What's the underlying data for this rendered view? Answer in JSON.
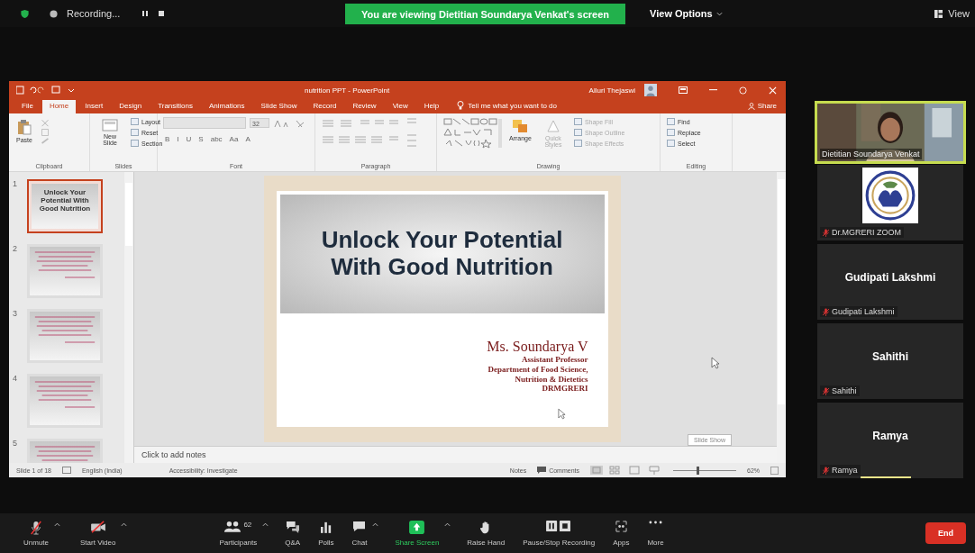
{
  "meeting_bar": {
    "recording": "Recording...",
    "banner": "You are viewing Dietitian Soundarya Venkat's screen",
    "view_options": "View Options",
    "view": "View"
  },
  "powerpoint": {
    "title": "nutrition PPT - PowerPoint",
    "user": "Alluri Thejaswi",
    "tabs": [
      {
        "label": "File",
        "selected": false
      },
      {
        "label": "Home",
        "selected": true
      },
      {
        "label": "Insert",
        "selected": false
      },
      {
        "label": "Design",
        "selected": false
      },
      {
        "label": "Transitions",
        "selected": false
      },
      {
        "label": "Animations",
        "selected": false
      },
      {
        "label": "Slide Show",
        "selected": false
      },
      {
        "label": "Record",
        "selected": false
      },
      {
        "label": "Review",
        "selected": false
      },
      {
        "label": "View",
        "selected": false
      },
      {
        "label": "Help",
        "selected": false
      }
    ],
    "tell_me": "Tell me what you want to do",
    "share": "Share",
    "ribbon": {
      "clipboard": {
        "label": "Clipboard",
        "paste": "Paste"
      },
      "slides": {
        "label": "Slides",
        "new_slide": "New Slide",
        "layout": "Layout",
        "reset": "Reset",
        "section": "Section"
      },
      "font": {
        "label": "Font",
        "size": "32",
        "buttons": [
          "B",
          "I",
          "U",
          "S",
          "abc",
          "Aa",
          "A"
        ]
      },
      "paragraph": {
        "label": "Paragraph"
      },
      "drawing": {
        "label": "Drawing",
        "arrange": "Arrange",
        "quick_styles": "Quick Styles",
        "shape_fill": "Shape Fill",
        "shape_outline": "Shape Outline",
        "shape_effects": "Shape Effects"
      },
      "editing": {
        "label": "Editing",
        "find": "Find",
        "replace": "Replace",
        "select": "Select"
      }
    },
    "thumbnails": [
      {
        "number": "1",
        "selected": true,
        "title": "Unlock Your Potential With Good Nutrition"
      },
      {
        "number": "2",
        "selected": false
      },
      {
        "number": "3",
        "selected": false
      },
      {
        "number": "4",
        "selected": false
      },
      {
        "number": "5",
        "selected": false
      }
    ],
    "slide": {
      "title": "Unlock Your Potential With Good Nutrition",
      "presenter": "Ms. Soundarya V",
      "lines": [
        "Assistant Professor",
        "Department of Food Science,",
        "Nutrition & Dietetics",
        "DRMGRERI"
      ]
    },
    "notes_placeholder": "Click to add notes",
    "tooltip": "Slide Show",
    "status": {
      "slide": "Slide 1 of 18",
      "language": "English (India)",
      "accessibility": "Accessibility: Investigate",
      "notes": "Notes",
      "comments": "Comments",
      "zoom": "62%",
      "level": 0.37
    }
  },
  "participants": [
    {
      "kind": "video",
      "name": "Dietitian Soundarya Venkat",
      "speaking": true
    },
    {
      "kind": "logo",
      "name": "Dr.MGRERI ZOOM",
      "speaking": false,
      "muted": true
    },
    {
      "kind": "name",
      "display": "Gudipati Lakshmi",
      "name": "Gudipati Lakshmi",
      "speaking": false,
      "muted": true
    },
    {
      "kind": "name",
      "display": "Sahithi",
      "name": "Sahithi",
      "speaking": false,
      "muted": true
    },
    {
      "kind": "name",
      "display": "Ramya",
      "name": "Ramya",
      "speaking": false,
      "muted": true
    }
  ],
  "toolbar": [
    {
      "kind": "mic",
      "label": "Unmute",
      "caret": true
    },
    {
      "kind": "video",
      "label": "Start Video",
      "caret": true
    },
    {
      "kind": "participants",
      "label": "Participants",
      "count": "62",
      "caret": true
    },
    {
      "kind": "qa",
      "label": "Q&A",
      "caret": false
    },
    {
      "kind": "polls",
      "label": "Polls",
      "caret": false
    },
    {
      "kind": "chat",
      "label": "Chat",
      "caret": true
    },
    {
      "kind": "share",
      "label": "Share Screen",
      "caret": true
    },
    {
      "kind": "hand",
      "label": "Raise Hand",
      "caret": false
    },
    {
      "kind": "record",
      "label": "Pause/Stop Recording",
      "caret": false
    },
    {
      "kind": "apps",
      "label": "Apps",
      "caret": false
    },
    {
      "kind": "more",
      "label": "More",
      "caret": false
    }
  ],
  "end": "End"
}
